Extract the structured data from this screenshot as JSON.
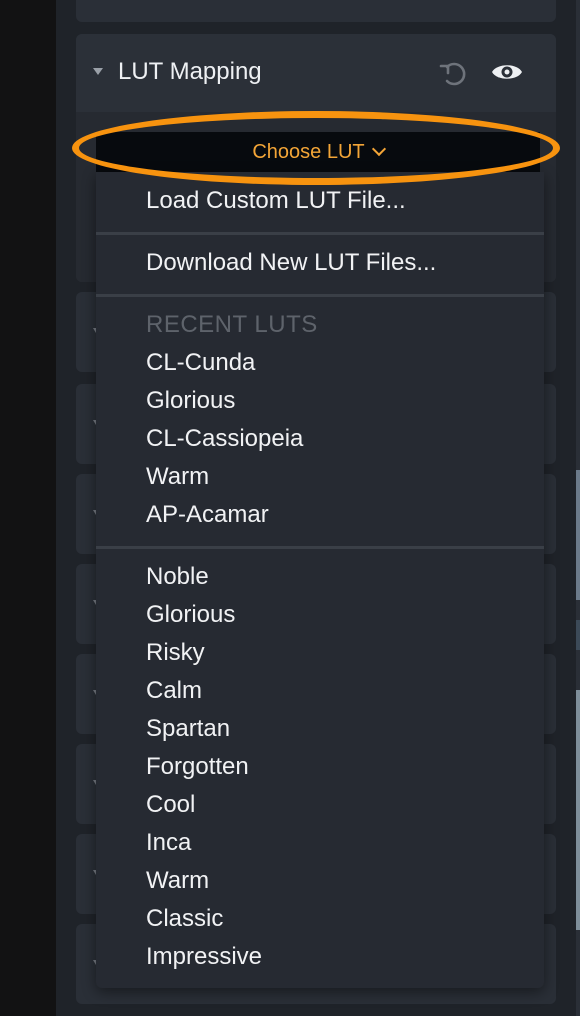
{
  "panel": {
    "section_title": "LUT Mapping"
  },
  "lut_selector": {
    "label": "Choose LUT"
  },
  "dropdown": {
    "actions": [
      {
        "label": "Load Custom LUT File..."
      },
      {
        "label": "Download New LUT Files..."
      }
    ],
    "recent_header": "RECENT LUTS",
    "recent": [
      "CL-Cunda",
      "Glorious",
      "CL-Cassiopeia",
      "Warm",
      "AP-Acamar"
    ],
    "luts": [
      "Noble",
      "Glorious",
      "Risky",
      "Calm",
      "Spartan",
      "Forgotten",
      "Cool",
      "Inca",
      "Warm",
      "Classic",
      "Impressive"
    ]
  },
  "colors": {
    "accent": "#f3a537",
    "highlight_ring": "#f7930f",
    "panel_bg": "#1f2329",
    "card_bg": "#2a2f37",
    "menu_bg": "#262a32"
  },
  "icons": {
    "reset": "undo-icon",
    "visibility": "eye-icon",
    "collapse": "triangle-down-icon",
    "dropdown": "chevron-down-icon"
  }
}
